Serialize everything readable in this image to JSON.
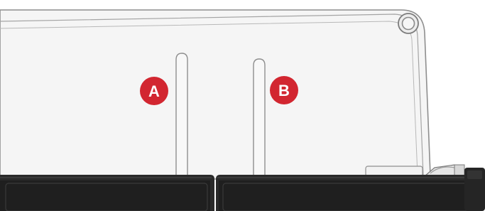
{
  "markers": {
    "a": {
      "label": "A",
      "color": "#d22630"
    },
    "b": {
      "label": "B",
      "color": "#d22630"
    }
  },
  "colors": {
    "panel_fill": "#f4f4f4",
    "outline": "#9a9a9a",
    "base_dark": "#2a2a2a",
    "base_face": "#1e1e1e",
    "background": "#ffffff"
  },
  "icons": {
    "screw": "screw-icon",
    "connector": "connector-icon"
  }
}
